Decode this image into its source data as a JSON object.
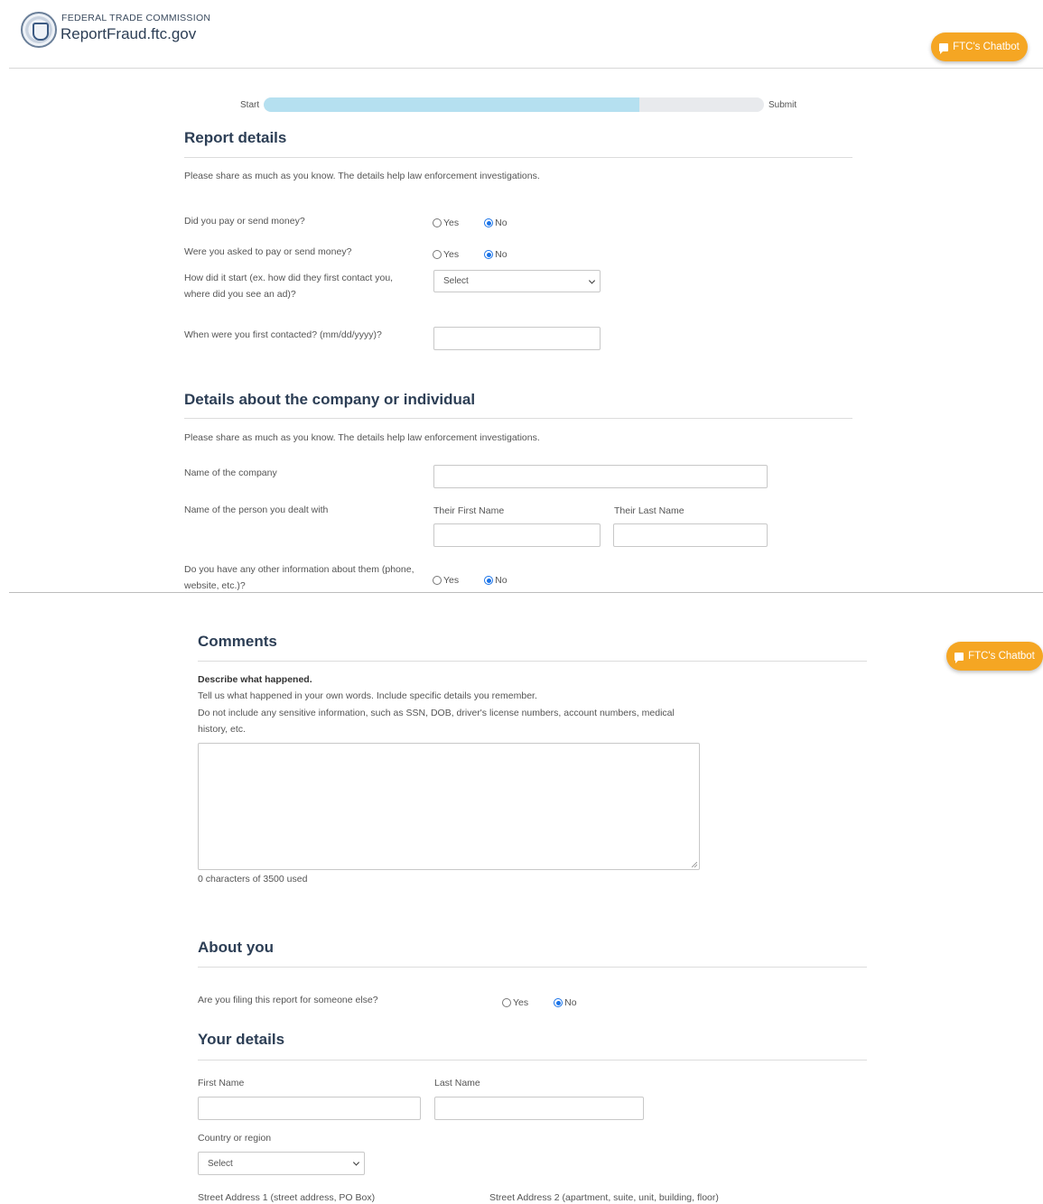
{
  "header": {
    "org_name": "FEDERAL TRADE COMMISSION",
    "site_name": "ReportFraud.ftc.gov",
    "chatbot_label": "FTC's Chatbot",
    "seal_icon": "ftc-seal-icon"
  },
  "progress": {
    "start_label": "Start",
    "end_label": "Submit",
    "percent": 75
  },
  "report_details": {
    "title": "Report details",
    "intro": "Please share as much as you know. The details help law enforcement investigations.",
    "q_paid": "Did you pay or send money?",
    "q_asked": "Were you asked to pay or send money?",
    "q_start": "How did it start (ex. how did they first contact you, where did you see an ad)?",
    "q_start_value": "Select",
    "q_contacted": "When were you first contacted? (mm/dd/yyyy)?",
    "yes": "Yes",
    "no": "No"
  },
  "company_details": {
    "title": "Details about the company or individual",
    "intro": "Please share as much as you know. The details help law enforcement investigations.",
    "company_label": "Name of the company",
    "person_label": "Name of the person you dealt with",
    "first_name_label": "Their First Name",
    "last_name_label": "Their Last Name",
    "other_info_label": "Do you have any other information about them (phone, website, etc.)?",
    "yes": "Yes",
    "no": "No"
  },
  "comments": {
    "title": "Comments",
    "describe_label": "Describe what happened.",
    "line1": "Tell us what happened in your own words. Include specific details you remember.",
    "line2": "Do not include any sensitive information, such as SSN, DOB, driver's license numbers, account numbers, medical history, etc.",
    "counter": "0 characters of 3500 used"
  },
  "about_you": {
    "title": "About you",
    "q_someone_else": "Are you filing this report for someone else?",
    "yes": "Yes",
    "no": "No"
  },
  "your_details": {
    "title": "Your details",
    "first_name": "First Name",
    "last_name": "Last Name",
    "country_label": "Country or region",
    "country_value": "Select",
    "street1": "Street Address 1 (street address, PO Box)",
    "street2": "Street Address 2 (apartment, suite, unit, building, floor)"
  },
  "colors": {
    "accent": "#f5a623",
    "heading": "#2c3e55",
    "progress_fill": "#b5e0f0",
    "radio_selected": "#1a73e8"
  }
}
